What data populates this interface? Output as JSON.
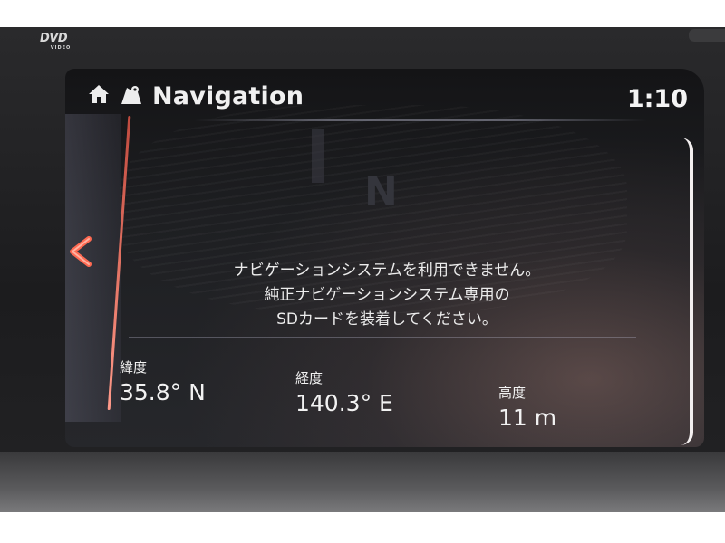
{
  "bezel": {
    "dvd_logo": "DVD",
    "dvd_logo_sub": "VIDEO"
  },
  "header": {
    "home_icon": "home-icon",
    "nav_icon": "map-pin-icon",
    "title": "Navigation",
    "clock": "1:10"
  },
  "side": {
    "back_icon": "chevron-left-icon"
  },
  "map": {
    "compass_label": "N"
  },
  "message": {
    "lines": [
      "ナビゲーションシステムを利用できません。",
      "純正ナビゲーションシステム専用の",
      "SDカードを装着してください。"
    ]
  },
  "readouts": {
    "latitude": {
      "label": "緯度",
      "value": "35.8° N"
    },
    "longitude": {
      "label": "経度",
      "value": "140.3° E"
    },
    "altitude": {
      "label": "高度",
      "value": "11 m"
    }
  },
  "colors": {
    "accent_red": "#e87a6a",
    "text": "#f0f0f0",
    "screen_bg": "#1e1f22"
  }
}
